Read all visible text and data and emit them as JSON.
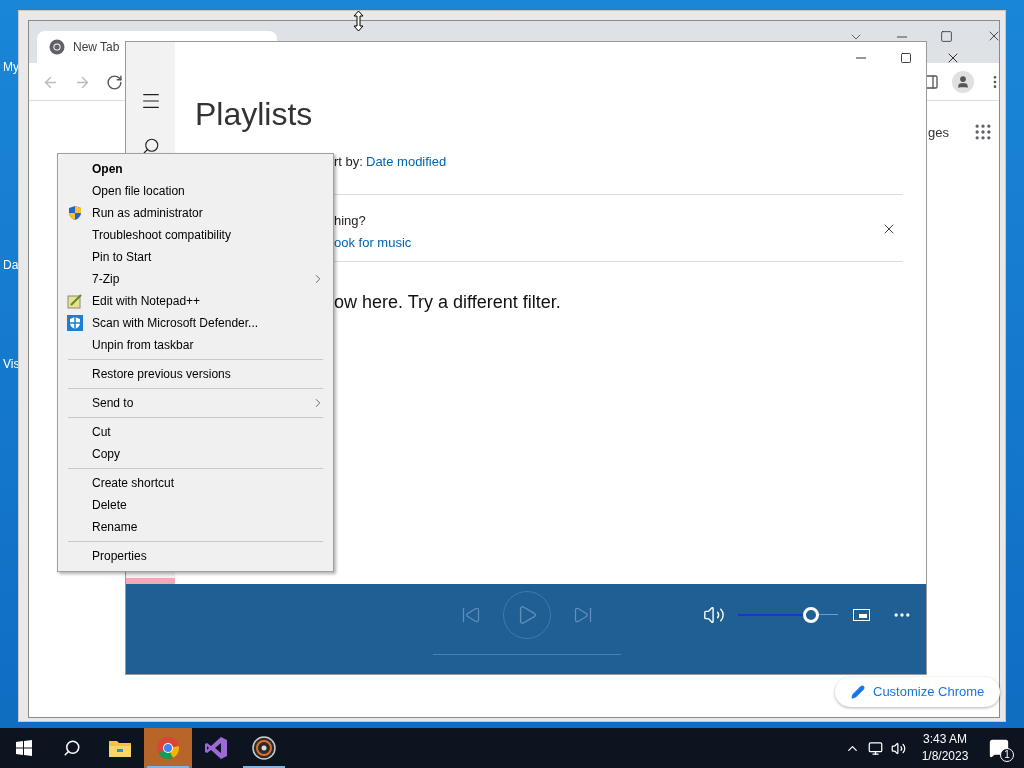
{
  "desktop": {
    "icons": [
      {
        "label": "My"
      },
      {
        "label": "Da"
      },
      {
        "label": "Vis"
      }
    ]
  },
  "browser": {
    "tab": {
      "title": "New Tab"
    },
    "partial_link": "ges",
    "customize_button": "Customize Chrome"
  },
  "music_app": {
    "title": "Playlists",
    "sort_label": "rt by:",
    "sort_value": "Date modified",
    "banner_text": "hing?",
    "banner_link": "ook for music",
    "empty_message": "ow here. Try a different filter.",
    "volume": {
      "level": 0.73
    }
  },
  "context_menu": {
    "items": [
      {
        "kind": "plain",
        "label": "Open",
        "bold": true,
        "submenu": false
      },
      {
        "kind": "plain",
        "label": "Open file location",
        "bold": false,
        "submenu": false
      },
      {
        "kind": "shield",
        "label": "Run as administrator",
        "bold": false,
        "submenu": false
      },
      {
        "kind": "plain",
        "label": "Troubleshoot compatibility",
        "bold": false,
        "submenu": false
      },
      {
        "kind": "plain",
        "label": "Pin to Start",
        "bold": false,
        "submenu": false
      },
      {
        "kind": "plain",
        "label": "7-Zip",
        "bold": false,
        "submenu": true
      },
      {
        "kind": "notepad",
        "label": "Edit with Notepad++",
        "bold": false,
        "submenu": false
      },
      {
        "kind": "defender",
        "label": "Scan with Microsoft Defender...",
        "bold": false,
        "submenu": false
      },
      {
        "kind": "plain",
        "label": "Unpin from taskbar",
        "bold": false,
        "submenu": false
      },
      {
        "kind": "separator"
      },
      {
        "kind": "plain",
        "label": "Restore previous versions",
        "bold": false,
        "submenu": false
      },
      {
        "kind": "separator"
      },
      {
        "kind": "plain",
        "label": "Send to",
        "bold": false,
        "submenu": true
      },
      {
        "kind": "separator"
      },
      {
        "kind": "plain",
        "label": "Cut",
        "bold": false,
        "submenu": false
      },
      {
        "kind": "plain",
        "label": "Copy",
        "bold": false,
        "submenu": false
      },
      {
        "kind": "separator"
      },
      {
        "kind": "plain",
        "label": "Create shortcut",
        "bold": false,
        "submenu": false
      },
      {
        "kind": "plain",
        "label": "Delete",
        "bold": false,
        "submenu": false
      },
      {
        "kind": "plain",
        "label": "Rename",
        "bold": false,
        "submenu": false
      },
      {
        "kind": "separator"
      },
      {
        "kind": "plain",
        "label": "Properties",
        "bold": false,
        "submenu": false
      }
    ]
  },
  "taskbar": {
    "apps": [
      {
        "kind": "explorer",
        "selected": false,
        "running": false
      },
      {
        "kind": "chrome",
        "selected": true,
        "running": true
      },
      {
        "kind": "studio",
        "selected": false,
        "running": false
      },
      {
        "kind": "disc",
        "selected": false,
        "running": true
      }
    ],
    "time": "3:43 AM",
    "date": "1/8/2023",
    "notification_count": "1"
  }
}
